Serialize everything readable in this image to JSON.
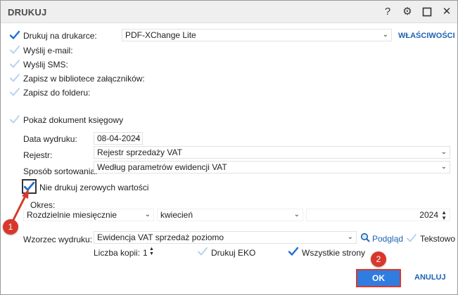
{
  "window": {
    "title": "DRUKUJ"
  },
  "titlebar_icons": [
    "help-icon",
    "gear-icon",
    "maximize-icon",
    "close-icon"
  ],
  "print_options": {
    "print_on_printer": {
      "label": "Drukuj na drukarce:",
      "checked": true,
      "printer": "PDF-XChange Lite",
      "properties_link": "WŁAŚCIWOŚCI"
    },
    "send_email": {
      "label": "Wyślij e-mail:",
      "checked": false
    },
    "send_sms": {
      "label": "Wyślij SMS:",
      "checked": false
    },
    "save_attachments": {
      "label": "Zapisz w bibliotece załączników:",
      "checked": false
    },
    "save_folder": {
      "label": "Zapisz do folderu:",
      "checked": false
    }
  },
  "show_document": {
    "label": "Pokaż dokument księgowy",
    "checked": false
  },
  "form": {
    "print_date_label": "Data wydruku:",
    "print_date_value": "08-04-2024",
    "register_label": "Rejestr:",
    "register_value": "Rejestr sprzedaży VAT",
    "sort_label": "Sposób sortowania:",
    "sort_value": "Według parametrów ewidencji VAT",
    "no_zero_label": "Nie drukuj zerowych wartości",
    "no_zero_checked": true,
    "period_label": "Okres:",
    "period_type": "Rozdzielnie miesięcznie",
    "period_month": "kwiecień",
    "period_year": "2024",
    "template_label": "Wzorzec wydruku:",
    "template_value": "Ewidencja VAT sprzedaż poziomo",
    "preview_link": "Podgląd",
    "text_label": "Tekstowo",
    "text_checked": false,
    "copies_label": "Liczba kopii:",
    "copies_value": "1",
    "eko_label": "Drukuj EKO",
    "eko_checked": false,
    "all_pages_label": "Wszystkie strony",
    "all_pages_checked": true
  },
  "annotations": {
    "badge1": "1",
    "badge2": "2"
  },
  "buttons": {
    "ok": "OK",
    "cancel": "ANULUJ"
  },
  "colors": {
    "accent": "#2f7de1",
    "link": "#1d63b3",
    "annotation": "#d8382c",
    "check_on": "#1f6fd1",
    "check_off": "#b9d2ef"
  }
}
